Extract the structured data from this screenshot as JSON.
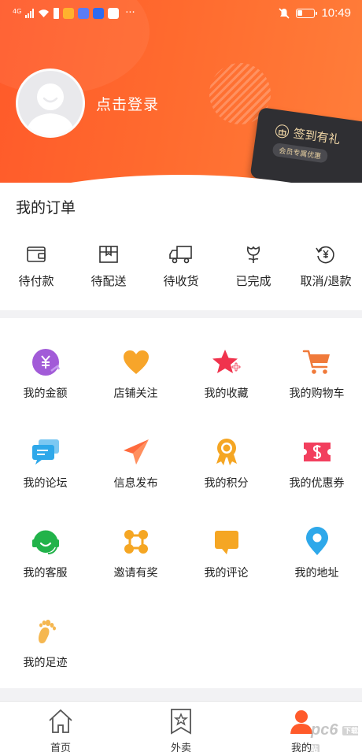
{
  "status_bar": {
    "network": "4G",
    "time": "10:49",
    "more": "···"
  },
  "profile": {
    "login_text": "点击登录"
  },
  "signin_card": {
    "title": "签到有礼",
    "subtitle": "会员专属优惠"
  },
  "orders": {
    "title": "我的订单",
    "items": [
      {
        "label": "待付款",
        "icon": "wallet-icon"
      },
      {
        "label": "待配送",
        "icon": "package-icon"
      },
      {
        "label": "待收货",
        "icon": "truck-icon"
      },
      {
        "label": "已完成",
        "icon": "flower-icon"
      },
      {
        "label": "取消/退款",
        "icon": "refund-icon"
      }
    ]
  },
  "services": [
    {
      "label": "我的金额",
      "icon": "money-icon",
      "color": "#a25bd8"
    },
    {
      "label": "店铺关注",
      "icon": "heart-icon",
      "color": "#f7a52a"
    },
    {
      "label": "我的收藏",
      "icon": "star-icon",
      "color": "#f0334d"
    },
    {
      "label": "我的购物车",
      "icon": "cart-icon",
      "color": "#f07a3a"
    },
    {
      "label": "我的论坛",
      "icon": "chat-icon",
      "color": "#2ea8ea"
    },
    {
      "label": "信息发布",
      "icon": "paper-plane-icon",
      "color": "#ff6b3d"
    },
    {
      "label": "我的积分",
      "icon": "medal-icon",
      "color": "#f5a623"
    },
    {
      "label": "我的优惠券",
      "icon": "coupon-icon",
      "color": "#f23f5e"
    },
    {
      "label": "我的客服",
      "icon": "headset-icon",
      "color": "#22b34a"
    },
    {
      "label": "邀请有奖",
      "icon": "invite-icon",
      "color": "#f5a623"
    },
    {
      "label": "我的评论",
      "icon": "comment-icon",
      "color": "#f5a623"
    },
    {
      "label": "我的地址",
      "icon": "location-icon",
      "color": "#2ea8ea"
    },
    {
      "label": "我的足迹",
      "icon": "footprint-icon",
      "color": "#f5b750"
    }
  ],
  "tabs": [
    {
      "label": "首页",
      "icon": "home-icon"
    },
    {
      "label": "外卖",
      "icon": "bookmark-star-icon"
    },
    {
      "label": "我的",
      "icon": "profile-icon",
      "active": true
    }
  ],
  "watermark": {
    "text": "pc6",
    "tag": "下载站"
  },
  "colors": {
    "primary": "#ff5a2a",
    "accent": "#ff7e3a",
    "text": "#222222"
  }
}
